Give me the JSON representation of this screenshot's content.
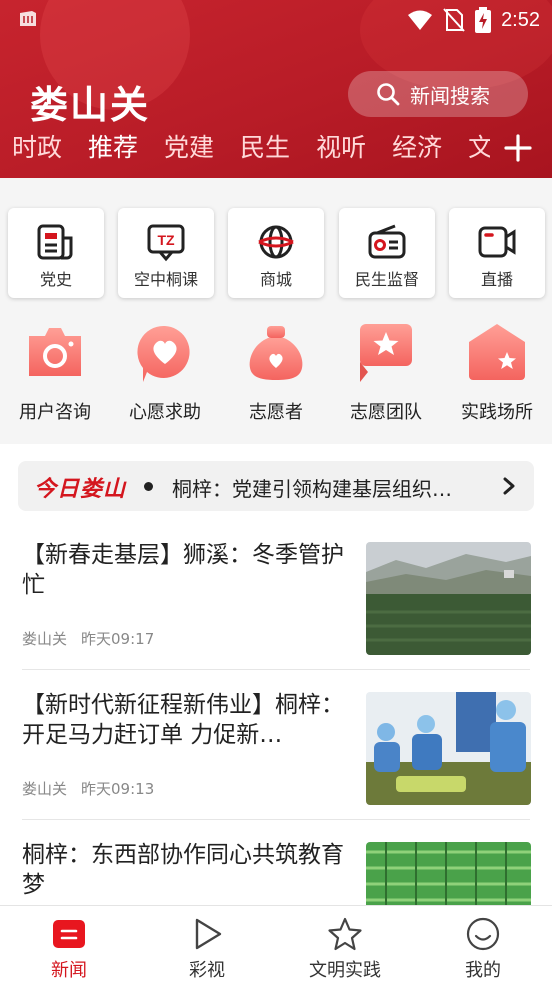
{
  "status_bar": {
    "time": "2:52"
  },
  "header": {
    "app_title": "娄山关",
    "search_label": "新闻搜索",
    "channels": [
      {
        "label": "时政",
        "active": false
      },
      {
        "label": "推荐",
        "active": true
      },
      {
        "label": "党建",
        "active": false
      },
      {
        "label": "民生",
        "active": false
      },
      {
        "label": "视听",
        "active": false
      },
      {
        "label": "经济",
        "active": false
      },
      {
        "label": "文",
        "active": false
      }
    ]
  },
  "services": [
    {
      "label": "党史",
      "icon": "newspaper-icon"
    },
    {
      "label": "空中桐课",
      "icon": "tz-chat-icon"
    },
    {
      "label": "商城",
      "icon": "globe-icon"
    },
    {
      "label": "民生监督",
      "icon": "radio-icon"
    },
    {
      "label": "直播",
      "icon": "video-camera-icon"
    }
  ],
  "volunteer": [
    {
      "label": "用户咨询",
      "icon": "camera-icon"
    },
    {
      "label": "心愿求助",
      "icon": "heart-bubble-icon"
    },
    {
      "label": "志愿者",
      "icon": "heart-bag-icon"
    },
    {
      "label": "志愿团队",
      "icon": "star-flag-icon"
    },
    {
      "label": "实践场所",
      "icon": "star-house-icon"
    }
  ],
  "ticker": {
    "logo": "今日娄山",
    "text": "桐梓：党建引领构建基层组织…"
  },
  "news": [
    {
      "title": "【新春走基层】狮溪：冬季管护忙",
      "source": "娄山关",
      "time": "昨天09:17"
    },
    {
      "title": "【新时代新征程新伟业】桐梓：开足马力赶订单 力促新…",
      "source": "娄山关",
      "time": "昨天09:13"
    },
    {
      "title": "桐梓：东西部协作同心共筑教育梦",
      "source": "",
      "time": ""
    }
  ],
  "bottom_nav": [
    {
      "label": "新闻",
      "icon": "news-tab-icon",
      "active": true
    },
    {
      "label": "彩视",
      "icon": "play-icon",
      "active": false
    },
    {
      "label": "文明实践",
      "icon": "star-outline-icon",
      "active": false
    },
    {
      "label": "我的",
      "icon": "smiley-icon",
      "active": false
    }
  ],
  "colors": {
    "brand_red": "#c7242e",
    "accent_red": "#d4161e",
    "icon_pink": "#f87a78"
  }
}
